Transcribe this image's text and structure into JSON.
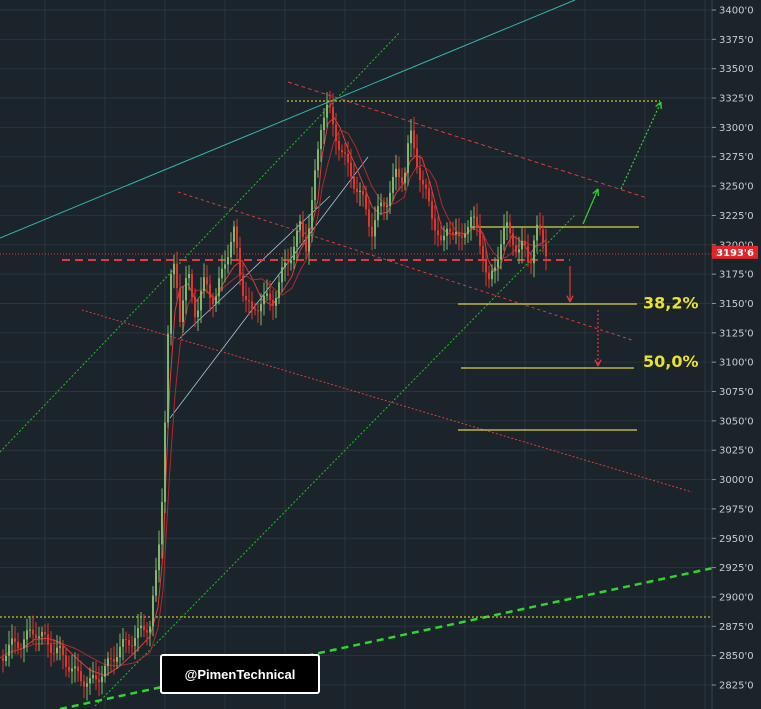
{
  "chart_data": {
    "type": "candlestick",
    "ylim": [
      2815,
      3410
    ],
    "y_ticks": [
      2825,
      2850,
      2875,
      2900,
      2925,
      2950,
      2975,
      3000,
      3025,
      3050,
      3075,
      3100,
      3125,
      3150,
      3175,
      3200,
      3225,
      3250,
      3275,
      3300,
      3325,
      3350,
      3375,
      3400
    ],
    "y_tick_labels": [
      "2825'0",
      "2850'0",
      "2875'0",
      "2900'0",
      "2925'0",
      "2950'0",
      "2975'0",
      "3000'0",
      "3025'0",
      "3050'0",
      "3075'0",
      "3100'0",
      "3125'0",
      "3150'0",
      "3175'0",
      "3200'0",
      "3225'0",
      "3250'0",
      "3275'0",
      "3300'0",
      "3325'0",
      "3350'0",
      "3375'0",
      "3400'0"
    ],
    "grid": true,
    "current_price": 3193.6,
    "current_price_label": "3193'6",
    "price_path": [
      [
        0,
        2848
      ],
      [
        10,
        2858
      ],
      [
        22,
        2862
      ],
      [
        35,
        2872
      ],
      [
        48,
        2860
      ],
      [
        60,
        2852
      ],
      [
        75,
        2835
      ],
      [
        90,
        2826
      ],
      [
        105,
        2838
      ],
      [
        118,
        2855
      ],
      [
        135,
        2866
      ],
      [
        150,
        2878
      ],
      [
        158,
        2930
      ],
      [
        163,
        3000
      ],
      [
        166,
        3080
      ],
      [
        170,
        3165
      ],
      [
        175,
        3185
      ],
      [
        180,
        3140
      ],
      [
        188,
        3175
      ],
      [
        196,
        3140
      ],
      [
        205,
        3170
      ],
      [
        215,
        3150
      ],
      [
        224,
        3185
      ],
      [
        234,
        3210
      ],
      [
        242,
        3165
      ],
      [
        252,
        3140
      ],
      [
        262,
        3155
      ],
      [
        272,
        3150
      ],
      [
        282,
        3175
      ],
      [
        292,
        3195
      ],
      [
        300,
        3215
      ],
      [
        306,
        3200
      ],
      [
        312,
        3235
      ],
      [
        318,
        3280
      ],
      [
        322,
        3310
      ],
      [
        328,
        3320
      ],
      [
        334,
        3295
      ],
      [
        340,
        3285
      ],
      [
        348,
        3265
      ],
      [
        356,
        3250
      ],
      [
        364,
        3235
      ],
      [
        372,
        3212
      ],
      [
        380,
        3232
      ],
      [
        388,
        3240
      ],
      [
        396,
        3260
      ],
      [
        404,
        3258
      ],
      [
        410,
        3295
      ],
      [
        416,
        3275
      ],
      [
        422,
        3252
      ],
      [
        430,
        3232
      ],
      [
        436,
        3215
      ],
      [
        442,
        3195
      ],
      [
        448,
        3220
      ],
      [
        454,
        3210
      ],
      [
        460,
        3200
      ],
      [
        466,
        3218
      ],
      [
        472,
        3222
      ],
      [
        478,
        3210
      ],
      [
        484,
        3190
      ],
      [
        488,
        3162
      ],
      [
        494,
        3180
      ],
      [
        500,
        3200
      ],
      [
        506,
        3215
      ],
      [
        512,
        3208
      ],
      [
        518,
        3192
      ],
      [
        524,
        3200
      ],
      [
        530,
        3185
      ],
      [
        536,
        3212
      ],
      [
        542,
        3208
      ],
      [
        547,
        3193
      ]
    ],
    "annotations": [
      {
        "text": "38,2%",
        "level": 3150
      },
      {
        "text": "50,0%",
        "level": 3100
      }
    ]
  },
  "colors": {
    "background": "#1b232b",
    "grid": "#2a343d",
    "up": "#7fb86b",
    "down": "#e5342a",
    "fib": "#e8e32a",
    "trend_green": "#1ec51e",
    "trend_red": "#e03a3a",
    "teal": "#30b8b0",
    "price_tag": "#e5242a"
  },
  "watermark": "@PimenTechnical"
}
